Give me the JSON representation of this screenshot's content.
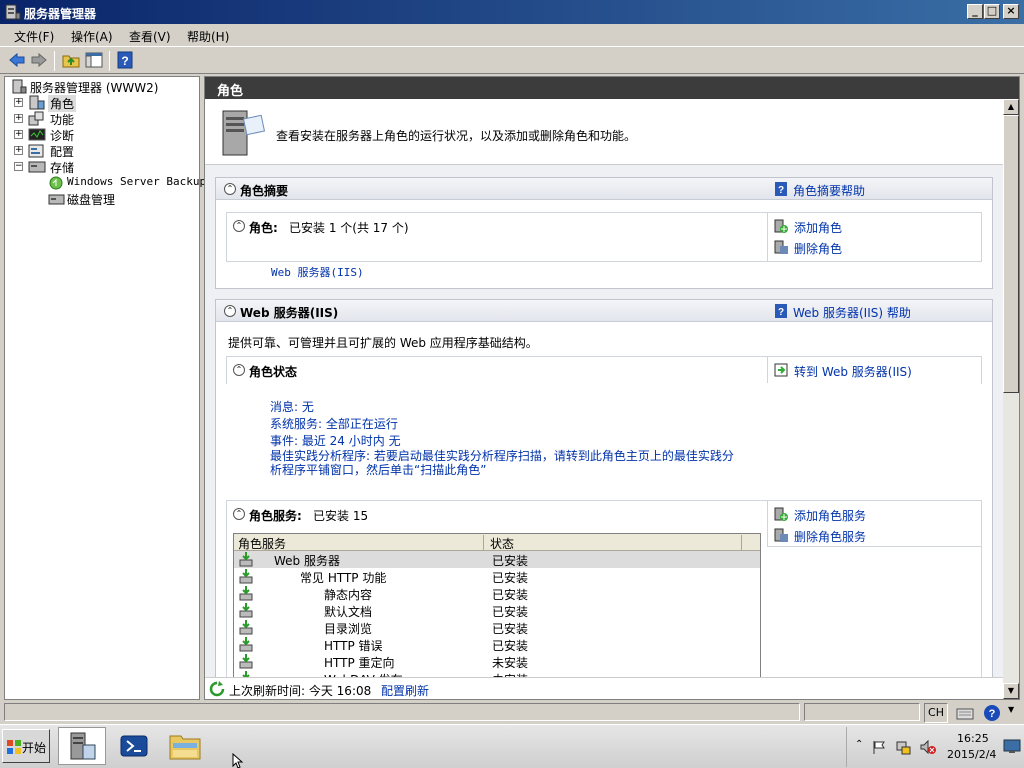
{
  "window": {
    "title": "服务器管理器"
  },
  "menu": [
    {
      "label": "文件(F)"
    },
    {
      "label": "操作(A)"
    },
    {
      "label": "查看(V)"
    },
    {
      "label": "帮助(H)"
    }
  ],
  "tree": {
    "root": "服务器管理器 (WWW2)",
    "nodes": [
      "角色",
      "功能",
      "诊断",
      "配置",
      "存储"
    ],
    "storage_children": [
      "Windows Server Backup",
      "磁盘管理"
    ]
  },
  "content": {
    "title": "角色",
    "banner_text": "查看安装在服务器上角色的运行状况，以及添加或删除角色和功能。",
    "summary": {
      "heading": "角色摘要",
      "help": "角色摘要帮助",
      "roles_label": "角色:",
      "roles_value": "已安装 1 个(共 17 个)",
      "role_link": "Web 服务器(IIS)",
      "add_role": "添加角色",
      "remove_role": "删除角色"
    },
    "web": {
      "heading": "Web 服务器(IIS)",
      "help": "Web 服务器(IIS) 帮助",
      "description": "提供可靠、可管理并且可扩展的 Web 应用程序基础结构。",
      "status_heading": "角色状态",
      "goto": "转到 Web 服务器(IIS)",
      "messages": "消息: 无",
      "system_services": "系统服务: 全部正在运行",
      "events": "事件: 最近 24 小时内 无",
      "bpa_line1": "最佳实践分析程序: 若要启动最佳实践分析程序扫描，请转到此角色主页上的最佳实践分",
      "bpa_line2": "析程序平铺窗口，然后单击“扫描此角色”",
      "services_label": "角色服务:",
      "services_value": "已安装 15",
      "add_service": "添加角色服务",
      "remove_service": "删除角色服务",
      "table_headers": [
        "角色服务",
        "状态"
      ],
      "rows": [
        {
          "name": "Web 服务器",
          "status": "已安装"
        },
        {
          "name": "常见 HTTP 功能",
          "status": "已安装"
        },
        {
          "name": "静态内容",
          "status": "已安装"
        },
        {
          "name": "默认文档",
          "status": "已安装"
        },
        {
          "name": "目录浏览",
          "status": "已安装"
        },
        {
          "name": "HTTP 错误",
          "status": "已安装"
        },
        {
          "name": "HTTP 重定向",
          "status": "未安装"
        },
        {
          "name": "WebDAV 发布",
          "status": "未安装"
        }
      ]
    },
    "refresh_label": "上次刷新时间: 今天 16:08",
    "refresh_link": "配置刷新"
  },
  "taskbar": {
    "start": "开始",
    "lang": "CH",
    "time": "16:25",
    "date": "2015/2/4"
  }
}
